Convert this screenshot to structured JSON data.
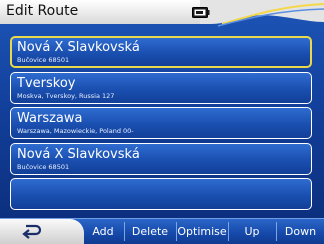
{
  "header": {
    "title": "Edit Route",
    "status_icon": "battery-icon"
  },
  "routes": [
    {
      "name": "Nová X Slavkovská",
      "detail": "Bučovice 68501",
      "selected": true
    },
    {
      "name": "Tverskoy",
      "detail": "Moskva, Tverskoy, Russia 127",
      "selected": false
    },
    {
      "name": "Warszawa",
      "detail": "Warszawa, Mazowieckie, Poland 00-",
      "selected": false
    },
    {
      "name": "Nová X Slavkovská",
      "detail": "Bučovice 68501",
      "selected": false
    },
    {
      "name": "",
      "detail": "",
      "selected": false
    }
  ],
  "toolbar": {
    "back_icon": "back-arrow-icon",
    "add": "Add",
    "delete": "Delete",
    "optimise": "Optimise",
    "up": "Up",
    "down": "Down"
  },
  "colors": {
    "background": "#123f9a",
    "selected_border": "#e8d84a",
    "header": "#ffffff"
  }
}
